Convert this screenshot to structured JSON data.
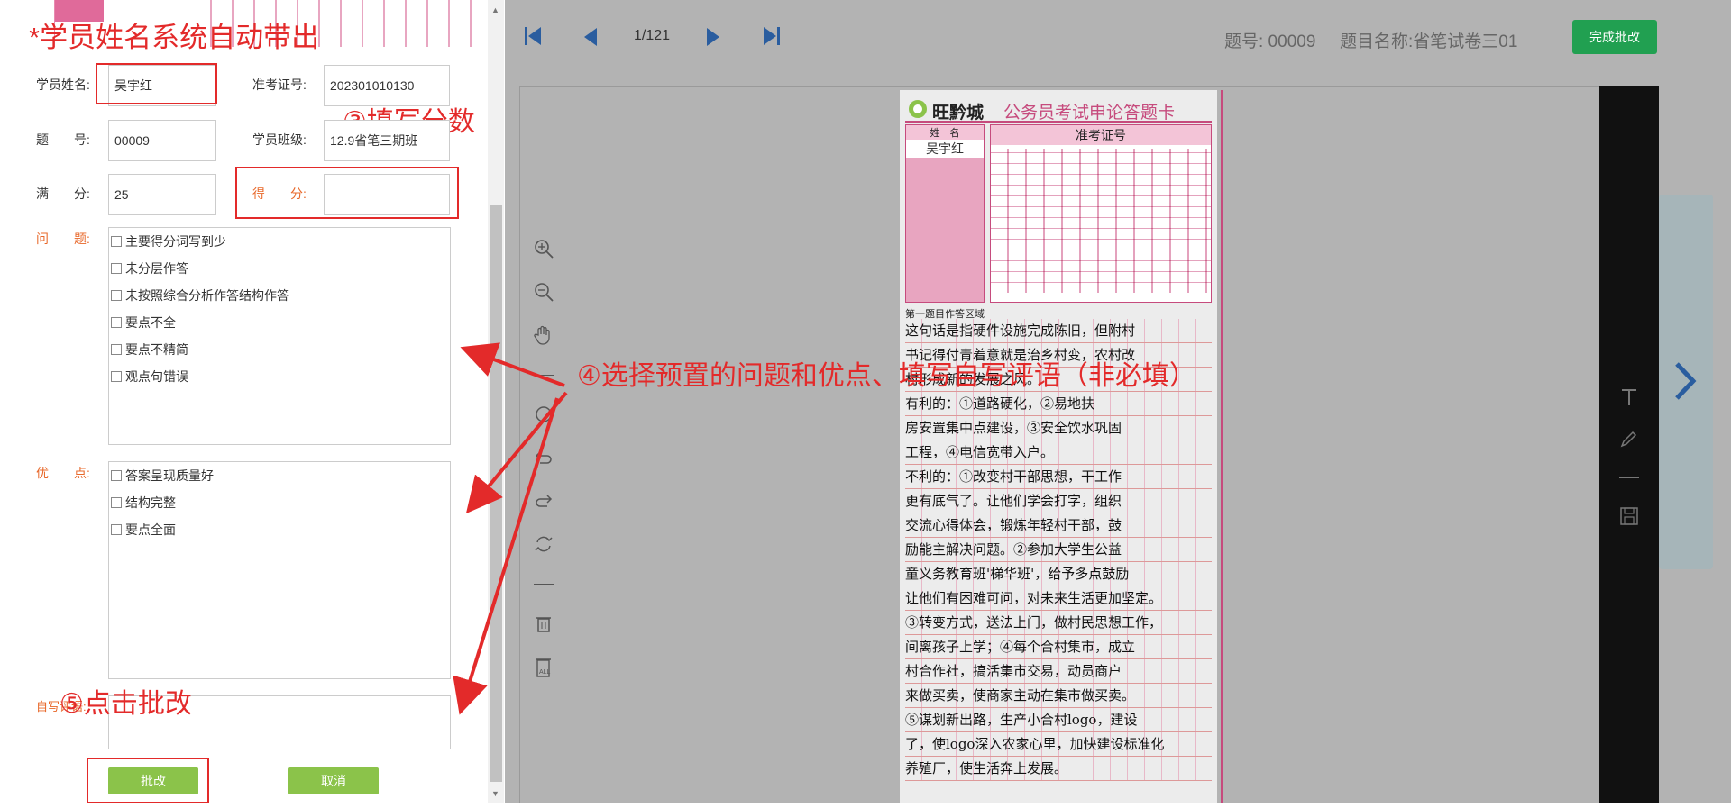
{
  "form": {
    "top_partial_label": "学员姓名系统自动带出",
    "student_name_label": "学员姓名:",
    "student_name_value": "吴宇红",
    "exam_no_label": "准考证号:",
    "exam_no_value": "202301010130",
    "question_no_label": "题　　号:",
    "question_no_value": "00009",
    "class_label": "学员班级:",
    "class_value": "12.9省笔三期班",
    "full_score_label": "满　　分:",
    "full_score_value": "25",
    "score_label": "得　　分:",
    "score_value": "",
    "problems_label": "问　　题:",
    "problems": [
      "主要得分词写到少",
      "未分层作答",
      "未按照综合分析作答结构作答",
      "要点不全",
      "要点不精简",
      "观点句错误"
    ],
    "merits_label": "优　　点:",
    "merits": [
      "答案呈现质量好",
      "结构完整",
      "要点全面"
    ],
    "comment_label": "自写评语:",
    "submit_label": "批改",
    "cancel_label": "取消"
  },
  "annotations": {
    "a1": "*学员姓名系统自动带出",
    "a3": "③填写分数",
    "a4": "④选择预置的问题和优点、填写自写评语（非必填）",
    "a5": "⑤点击批改"
  },
  "viewer": {
    "page_indicator": "1/121",
    "question_no_text": "题号: 00009",
    "question_name_text": "题目名称:省笔试卷三01",
    "done_button": "完成批改"
  },
  "sheet": {
    "brand": "旺黔城",
    "title": "公务员考试申论答题卡",
    "name_header": "姓　名",
    "name_value": "吴宇红",
    "exam_no_header": "准考证号",
    "area_label": "第一题目作答区域",
    "lines": [
      "这句话是指硬件设施完成陈旧，但附村",
      "书记得付青着意就是治乡村变，农村改",
      "村形成新的发展之风。",
      "有利的：①道路硬化，②易地扶",
      "房安置集中点建设，③安全饮水巩固",
      "工程，④电信宽带入户。",
      "不利的：①改变村干部思想，干工作",
      "更有底气了。让他们学会打字，组织",
      "交流心得体会，锻炼年轻村干部，鼓",
      "励能主解决问题。②参加大学生公益",
      "童义务教育班'梯华班'，给予多点鼓励",
      "让他们有困难可问，对未来生活更加坚定。",
      "③转变方式，送法上门，做村民思想工作，",
      "间离孩子上学；④每个合村集市，成立",
      "村合作社，搞活集市交易，动员商户",
      "来做买卖，使商家主动在集市做买卖。",
      "⑤谋划新出路，生产小合村logo，建设",
      "了，使logo深入农家心里，加快建设标准化",
      "养殖厂，使生活奔上发展。"
    ]
  },
  "colors": {
    "annotation_red": "#e32a2a",
    "orange_label": "#e8682a",
    "green_button": "#8bc34a",
    "done_green": "#21a051",
    "sheet_pink": "#c64b7d"
  }
}
